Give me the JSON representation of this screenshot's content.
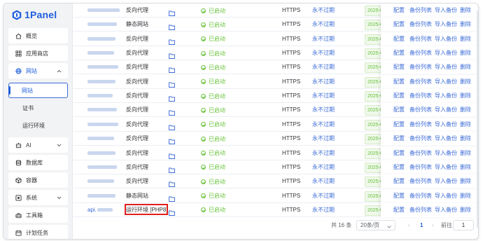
{
  "app": {
    "logo_text": "1Panel"
  },
  "sidebar": {
    "items": [
      {
        "label": "概览",
        "icon": "home-icon"
      },
      {
        "label": "应用商店",
        "icon": "grid-icon"
      },
      {
        "label": "网站",
        "icon": "globe-icon",
        "expanded": true
      },
      {
        "label": "网站",
        "active": true
      },
      {
        "label": "证书"
      },
      {
        "label": "运行环境"
      },
      {
        "label": "AI",
        "icon": "robot-icon"
      },
      {
        "label": "数据库",
        "icon": "database-icon"
      },
      {
        "label": "容器",
        "icon": "container-icon"
      },
      {
        "label": "系统",
        "icon": "system-icon"
      },
      {
        "label": "工具箱",
        "icon": "toolbox-icon"
      },
      {
        "label": "计划任务",
        "icon": "calendar-icon"
      }
    ]
  },
  "table": {
    "rows": [
      {
        "name": "",
        "type": "反向代理",
        "status": "已启动",
        "protocol": "HTTPS",
        "expiry": "永不过期",
        "date": "2025-0"
      },
      {
        "name": "",
        "type": "静态网站",
        "status": "已启动",
        "protocol": "HTTPS",
        "expiry": "永不过期",
        "date": "2025-0"
      },
      {
        "name": "",
        "type": "反向代理",
        "status": "已启动",
        "protocol": "HTTPS",
        "expiry": "永不过期",
        "date": "2025-0"
      },
      {
        "name": "",
        "type": "反向代理",
        "status": "已启动",
        "protocol": "HTTPS",
        "expiry": "永不过期",
        "date": "2025-0"
      },
      {
        "name": "",
        "type": "反向代理",
        "status": "已启动",
        "protocol": "HTTPS",
        "expiry": "永不过期",
        "date": "2025-0"
      },
      {
        "name": "",
        "type": "反向代理",
        "status": "已启动",
        "protocol": "HTTPS",
        "expiry": "永不过期",
        "date": "2025-0"
      },
      {
        "name": "",
        "type": "反向代理",
        "status": "已启动",
        "protocol": "HTTPS",
        "expiry": "永不过期",
        "date": "2025-0"
      },
      {
        "name": "",
        "type": "反向代理",
        "status": "已启动",
        "protocol": "HTTPS",
        "expiry": "永不过期",
        "date": "2025-0"
      },
      {
        "name": "",
        "type": "反向代理",
        "status": "已启动",
        "protocol": "HTTPS",
        "expiry": "永不过期",
        "date": "2025-0"
      },
      {
        "name": "",
        "type": "反向代理",
        "status": "已启动",
        "protocol": "HTTPS",
        "expiry": "永不过期",
        "date": "2025-0"
      },
      {
        "name": "",
        "type": "反向代理",
        "status": "已启动",
        "protocol": "HTTPS",
        "expiry": "永不过期",
        "date": "2025-0"
      },
      {
        "name": "",
        "type": "反向代理",
        "status": "已启动",
        "protocol": "HTTPS",
        "expiry": "永不过期",
        "date": "2025-0"
      },
      {
        "name": "",
        "type": "反向代理",
        "status": "已启动",
        "protocol": "HTTPS",
        "expiry": "永不过期",
        "date": "2025-0"
      },
      {
        "name": "",
        "type": "静态网站",
        "status": "已启动",
        "protocol": "HTTPS",
        "expiry": "永不过期",
        "date": "2025-0"
      },
      {
        "name": "api.",
        "type": "运行环境 [PHP8]",
        "status": "已启动",
        "protocol": "HTTPS",
        "expiry": "永不过期",
        "date": "2025-0"
      }
    ],
    "actions": [
      "配置",
      "备份列表",
      "导入备份",
      "删除"
    ]
  },
  "pagination": {
    "total": "共 16 条",
    "page_size": "20条/页",
    "prev": "‹",
    "current_page": "1",
    "next": "›",
    "goto_label": "前往",
    "goto_value": "1"
  },
  "colors": {
    "accent": "#1f5fdc",
    "status_green": "#67c23a",
    "highlight_red": "#e0201e"
  }
}
